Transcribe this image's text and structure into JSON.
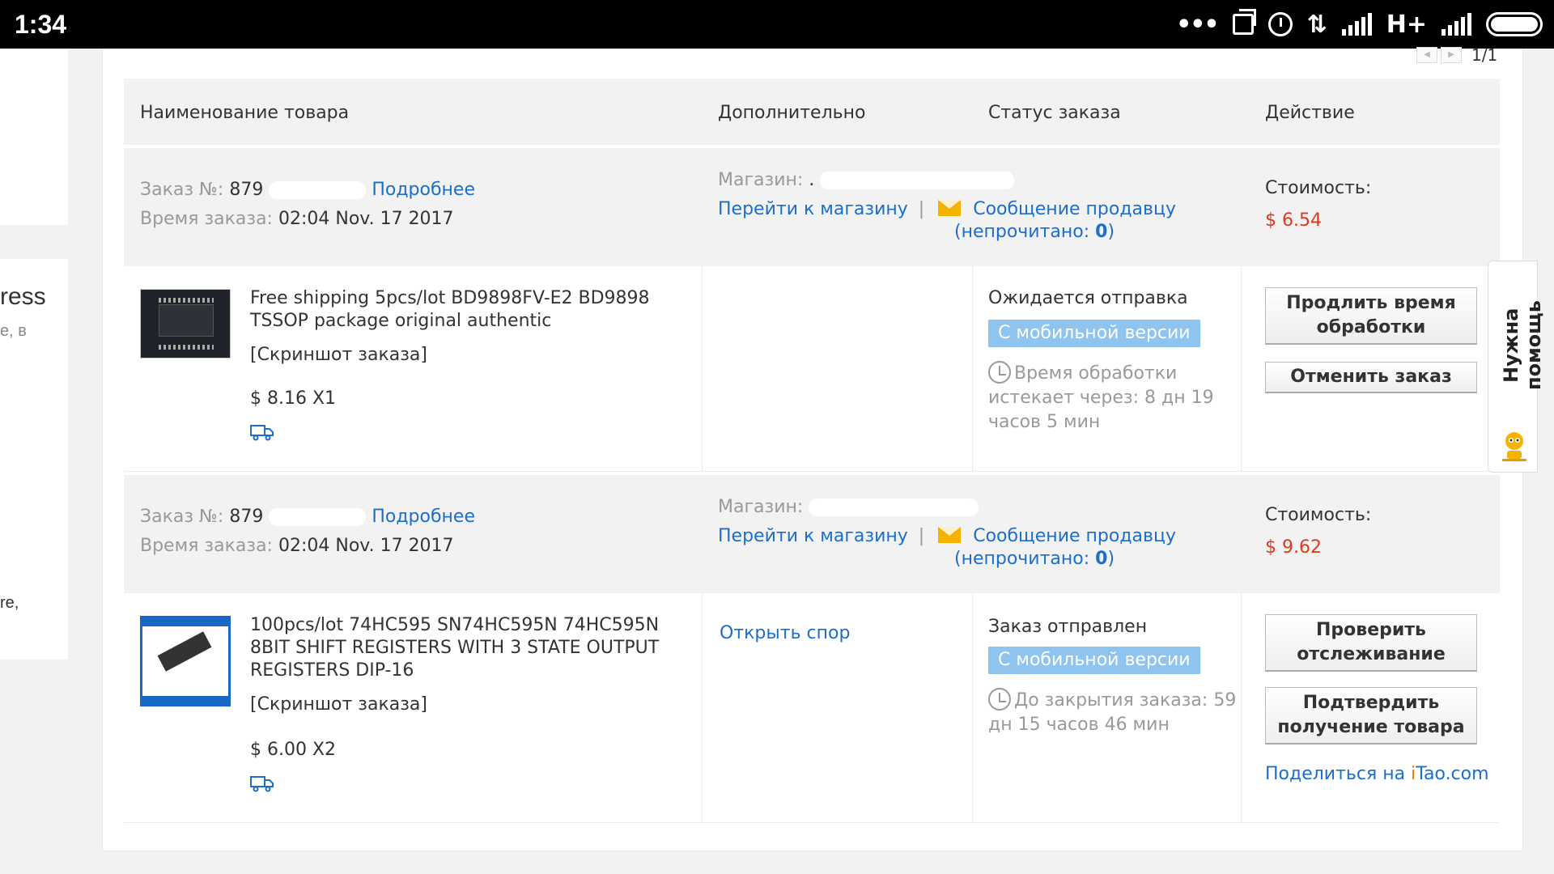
{
  "status_bar": {
    "time": "1:34",
    "dots": "•••",
    "network": "H+",
    "arrows": "⇅"
  },
  "background": {
    "left_title": "ress",
    "left_sub": "e, в",
    "left_bottom": "re,"
  },
  "pager": {
    "text": "1/1",
    "prev": "◀",
    "next": "▶"
  },
  "table": {
    "headers": {
      "product": "Наименование товара",
      "extra": "Дополнительно",
      "status": "Статус заказа",
      "action": "Действие"
    }
  },
  "orders": [
    {
      "order_label": "Заказ №:",
      "order_no": "879",
      "details_link": "Подробнее",
      "time_label": "Время заказа:",
      "time_value": "02:04 Nov. 17 2017",
      "shop_label": "Магазин:",
      "shop_value": ".",
      "goto_shop": "Перейти к магазину",
      "separator": "|",
      "msg_seller": "Сообщение продавцу",
      "unread_prefix": "(непрочитано: ",
      "unread_count": "0",
      "unread_suffix": ")",
      "cost_label": "Стоимость:",
      "cost_value": "$ 6.54",
      "product_title": "Free shipping 5pcs/lot BD9898FV-E2 BD9898 TSSOP package original authentic",
      "snapshot": "[Скриншот заказа]",
      "price_qty": "$ 8.16 X1",
      "extra_link": "",
      "status_text": "Ожидается отправка",
      "mobile_badge": "С мобильной версии",
      "timer_text": "Время обработки истекает через: 8 дн 19 часов 5 мин",
      "btn1": "Продлить время обработки",
      "btn2": "Отменить заказ",
      "share_prefix": "",
      "share_i": "",
      "share_tao": "",
      "share_com": ""
    },
    {
      "order_label": "Заказ №:",
      "order_no": "879",
      "details_link": "Подробнее",
      "time_label": "Время заказа:",
      "time_value": "02:04 Nov. 17 2017",
      "shop_label": "Магазин:",
      "shop_value": "",
      "goto_shop": "Перейти к магазину",
      "separator": "|",
      "msg_seller": "Сообщение продавцу",
      "unread_prefix": "(непрочитано: ",
      "unread_count": "0",
      "unread_suffix": ")",
      "cost_label": "Стоимость:",
      "cost_value": "$ 9.62",
      "product_title": "100pcs/lot 74HC595 SN74HC595N 74HC595N 8BIT SHIFT REGISTERS WITH 3 STATE OUTPUT REGISTERS DIP-16",
      "snapshot": "[Скриншот заказа]",
      "price_qty": "$ 6.00 X2",
      "extra_link": "Открыть спор",
      "status_text": "Заказ отправлен",
      "mobile_badge": "С мобильной версии",
      "timer_text": "До закрытия заказа: 59 дн 15 часов 46 мин",
      "btn1": "Проверить отслеживание",
      "btn2": "Подтвердить получение товара",
      "share_prefix": "Поделиться на ",
      "share_i": "i",
      "share_tao": "Tao",
      "share_com": ".com"
    }
  ],
  "help": {
    "label": "Нужна помощь"
  },
  "colors": {
    "link": "#1c6fc9",
    "price": "#e0381c",
    "badge": "#8ec4ee",
    "header_bg": "#f2f2f2"
  }
}
